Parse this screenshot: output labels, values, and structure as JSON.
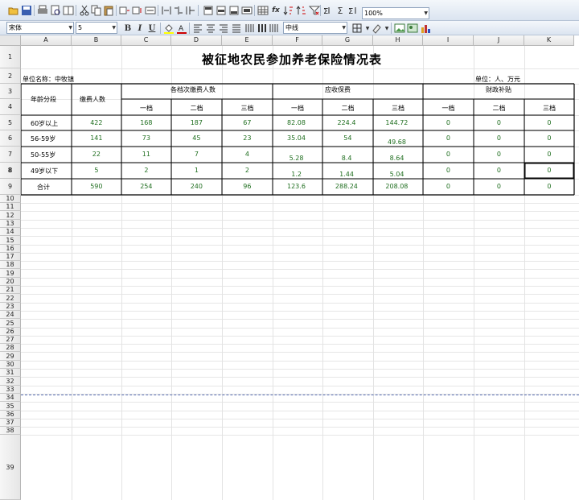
{
  "toolbar": {
    "zoom": "100%",
    "font_name": "宋体",
    "font_size": "5",
    "line_style": "中线",
    "fx": "fx",
    "sum": "Σ"
  },
  "sheet": {
    "columns": [
      "A",
      "B",
      "C",
      "D",
      "E",
      "F",
      "G",
      "H",
      "I",
      "J",
      "K"
    ],
    "rows": [
      "1",
      "2",
      "3",
      "4",
      "5",
      "6",
      "7",
      "8",
      "9",
      "10",
      "11",
      "12",
      "13",
      "14",
      "15",
      "16",
      "17",
      "18",
      "19",
      "20",
      "21",
      "22",
      "23",
      "24",
      "25",
      "26",
      "27",
      "28",
      "29",
      "30",
      "31",
      "32",
      "33",
      "34",
      "35",
      "36",
      "37",
      "38",
      "39"
    ],
    "title": "被征地农民参加养老保险情况表",
    "unit_name": "单位名称：中牧镇",
    "unit": "单位：人、万元",
    "headers": {
      "age_group": "年龄分段",
      "payers": "缴费人数",
      "by_level": "各档次缴费人数",
      "premium": "应收保费",
      "subsidy": "财政补贴",
      "levels": [
        "一档",
        "二档",
        "三档"
      ]
    },
    "data_rows": [
      {
        "label": "60岁以上",
        "values": [
          "422",
          "168",
          "187",
          "67",
          "82.08",
          "224.4",
          "144.72",
          "0",
          "0",
          "0"
        ]
      },
      {
        "label": "56-59岁",
        "values": [
          "141",
          "73",
          "45",
          "23",
          "35.04",
          "54",
          "49.68",
          "0",
          "0",
          "0"
        ]
      },
      {
        "label": "50-55岁",
        "values": [
          "22",
          "11",
          "7",
          "4",
          "5.28",
          "8.4",
          "8.64",
          "0",
          "0",
          "0"
        ]
      },
      {
        "label": "49岁以下",
        "values": [
          "5",
          "2",
          "1",
          "2",
          "1.2",
          "1.44",
          "5.04",
          "0",
          "0",
          "0"
        ]
      },
      {
        "label": "合计",
        "values": [
          "590",
          "254",
          "240",
          "96",
          "123.6",
          "288.24",
          "208.08",
          "0",
          "0",
          "0"
        ]
      }
    ]
  }
}
